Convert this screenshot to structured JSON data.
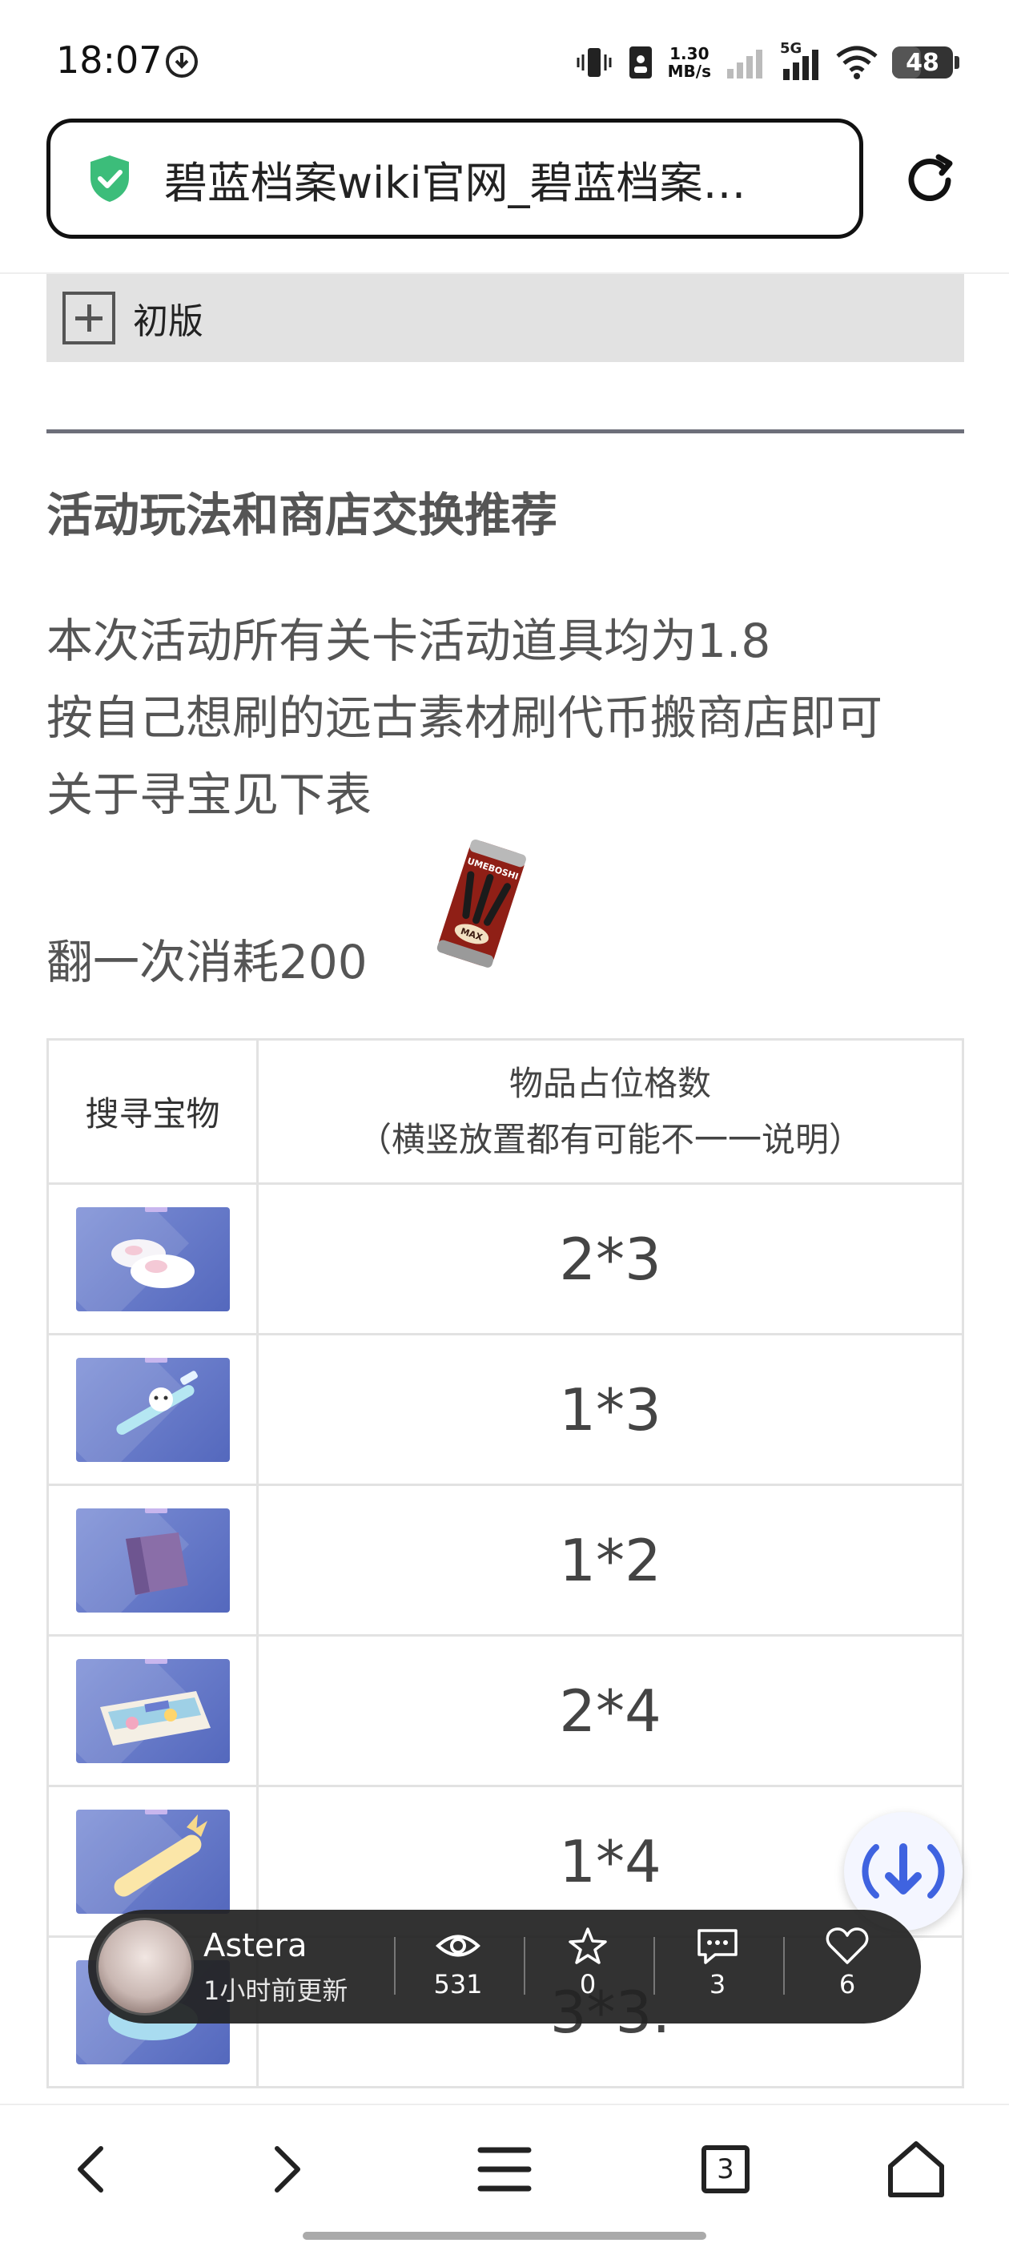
{
  "status_bar": {
    "time": "18:07",
    "net_speed_value": "1.30",
    "net_speed_unit": "MB/s",
    "network_label": "5G",
    "battery": "48"
  },
  "address_bar": {
    "title": "碧蓝档案wiki官网_碧蓝档案…"
  },
  "content": {
    "collapse_label": "初版",
    "section_title": "活动玩法和商店交换推荐",
    "paragraph_lines": [
      "本次活动所有关卡活动道具均为1.8",
      "按自己想刷的远古素材刷代币搬商店即可",
      "关于寻宝见下表"
    ],
    "consume_text": "翻一次消耗200",
    "can_text": "UMEBOSHI",
    "can_badge": "MAX"
  },
  "table": {
    "header_item": "搜寻宝物",
    "header_grid_line1": "物品占位格数",
    "header_grid_line2": "（横竖放置都有可能不一一说明）",
    "rows": [
      {
        "icon": "slippers-icon",
        "value": "2*3"
      },
      {
        "icon": "toothbrush-icon",
        "value": "1*3"
      },
      {
        "icon": "cloth-icon",
        "value": "1*2"
      },
      {
        "icon": "board-game-box-icon",
        "value": "2*4"
      },
      {
        "icon": "bolster-pillow-icon",
        "value": "1*4"
      },
      {
        "icon": "cushion-icon",
        "value": "3*3."
      }
    ]
  },
  "author_bar": {
    "name": "Astera",
    "updated": "1小时前更新",
    "views": "531",
    "stars": "0",
    "comments": "3",
    "likes": "6"
  },
  "bottom_nav": {
    "tab_count": "3"
  },
  "colors": {
    "accent_green": "#3cbd7a",
    "fab_blue": "#3f63e0",
    "thumb_blue": "#6a7dd0"
  }
}
